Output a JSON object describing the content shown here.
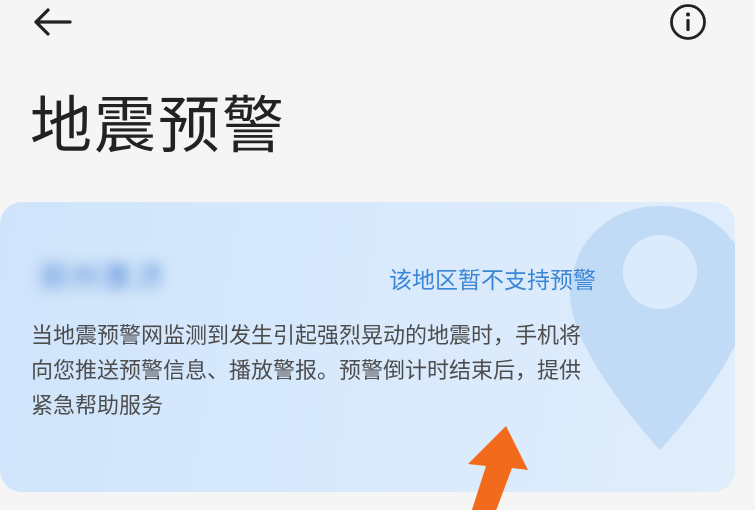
{
  "header": {
    "back_icon": "arrow-left-icon",
    "info_icon": "info-circle-icon"
  },
  "page": {
    "title": "地震预警"
  },
  "card": {
    "location": "郑州惠济",
    "region_status": "该地区暂不支持预警",
    "description": "当地震预警网监测到发生引起强烈晃动的地震时，手机将向您推送预警信息、播放警报。预警倒计时结束后，提供紧急帮助服务",
    "decoration_icon": "map-pin-icon"
  },
  "colors": {
    "background": "#f5f5f5",
    "card": "#d6e8fb",
    "accent": "#3a86d6",
    "annotation_arrow": "#f26a1b"
  }
}
